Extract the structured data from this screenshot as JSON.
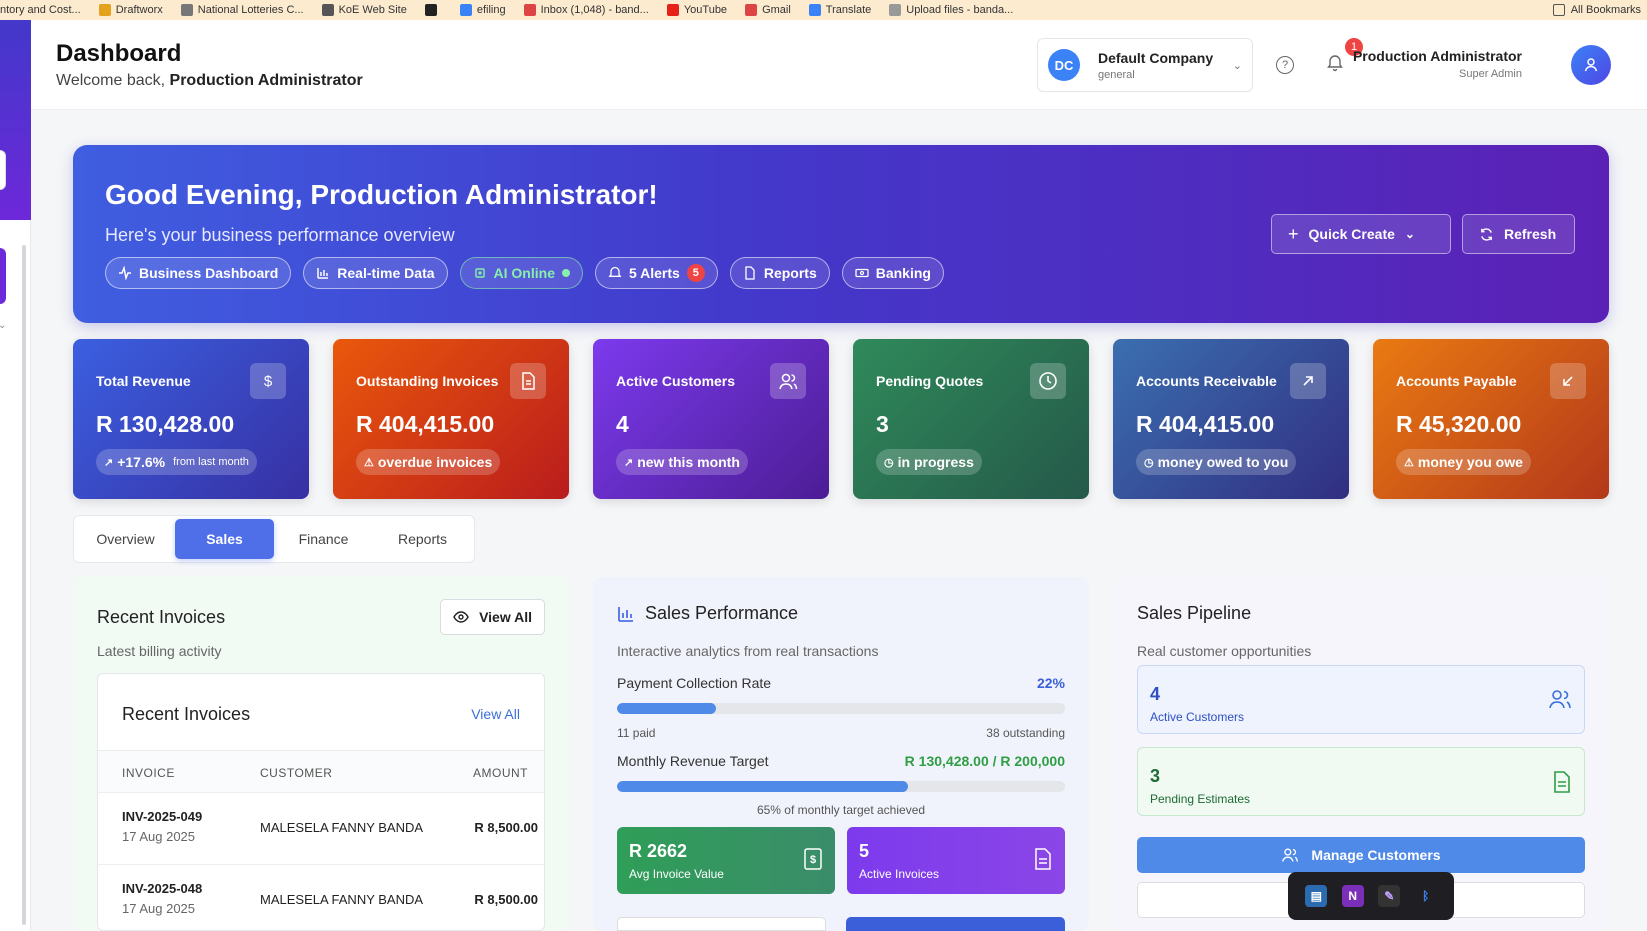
{
  "bookmarks": [
    {
      "label": "ntory and Cost...",
      "color": "#888"
    },
    {
      "label": "Draftworx",
      "color": "#e4a11b"
    },
    {
      "label": "National Lotteries C...",
      "color": "#777"
    },
    {
      "label": "KoE Web Site",
      "color": "#555"
    },
    {
      "label": "",
      "color": "#222"
    },
    {
      "label": "efiling",
      "color": "#3b82f6"
    },
    {
      "label": "Inbox (1,048) - band...",
      "color": "#d44"
    },
    {
      "label": "YouTube",
      "color": "#e62117"
    },
    {
      "label": "Gmail",
      "color": "#d44"
    },
    {
      "label": "Translate",
      "color": "#3b82f6"
    },
    {
      "label": "Upload files - banda...",
      "color": "#999"
    }
  ],
  "bookmarks_all": "All Bookmarks",
  "header": {
    "title": "Dashboard",
    "welcome_prefix": "Welcome back,",
    "welcome_name": "Production Administrator",
    "company_initials": "DC",
    "company_name": "Default Company",
    "company_sub": "general",
    "notifications": "1",
    "user_name": "Production Administrator",
    "user_role": "Super Admin"
  },
  "hero": {
    "greeting": "Good Evening, Production Administrator!",
    "subtitle": "Here's your business performance overview",
    "chips": {
      "business": "Business Dashboard",
      "realtime": "Real-time Data",
      "ai": "AI Online",
      "alerts": "5 Alerts",
      "alerts_count": "5",
      "reports": "Reports",
      "banking": "Banking"
    },
    "quick_create": "Quick Create",
    "refresh": "Refresh"
  },
  "kpis": [
    {
      "label": "Total Revenue",
      "value": "R 130,428.00",
      "pill": "+17.6%",
      "pill_note": "from last month",
      "icon": "dollar-icon",
      "gradient": [
        "#3b5fe0",
        "#3730a3"
      ]
    },
    {
      "label": "Outstanding Invoices",
      "value": "R 404,415.00",
      "pill": "overdue invoices",
      "icon": "document-icon",
      "gradient": [
        "#ea580c",
        "#b91c1c"
      ]
    },
    {
      "label": "Active Customers",
      "value": "4",
      "pill": "new this month",
      "icon": "users-icon",
      "gradient": [
        "#7c3aed",
        "#4c1d95"
      ]
    },
    {
      "label": "Pending Quotes",
      "value": "3",
      "pill": "in progress",
      "icon": "clock-icon",
      "gradient": [
        "#2f8a5a",
        "#25594a"
      ]
    },
    {
      "label": "Accounts Receivable",
      "value": "R 404,415.00",
      "pill": "money owed to you",
      "icon": "arrow-up-right-icon",
      "gradient": [
        "#3b6fb0",
        "#312e81"
      ]
    },
    {
      "label": "Accounts Payable",
      "value": "R 45,320.00",
      "pill": "money you owe",
      "icon": "arrow-down-left-icon",
      "gradient": [
        "#ea7a12",
        "#b3381a"
      ]
    }
  ],
  "tabs": [
    "Overview",
    "Sales",
    "Finance",
    "Reports"
  ],
  "active_tab": "Sales",
  "recent": {
    "title": "Recent Invoices",
    "subtitle": "Latest billing activity",
    "view_all_btn": "View All",
    "inner_title": "Recent Invoices",
    "inner_view_all": "View All",
    "columns": [
      "INVOICE",
      "CUSTOMER",
      "AMOUNT"
    ],
    "rows": [
      {
        "invoice": "INV-2025-049",
        "date": "17 Aug 2025",
        "customer": "MALESELA FANNY BANDA",
        "amount": "R 8,500.00"
      },
      {
        "invoice": "INV-2025-048",
        "date": "17 Aug 2025",
        "customer": "MALESELA FANNY BANDA",
        "amount": "R 8,500.00"
      }
    ]
  },
  "sales": {
    "title": "Sales Performance",
    "subtitle": "Interactive analytics from real transactions",
    "collection_label": "Payment Collection Rate",
    "collection_value": "22%",
    "collection_fraction": 0.22,
    "paid": "11 paid",
    "outstanding": "38 outstanding",
    "target_label": "Monthly Revenue Target",
    "target_value": "R 130,428.00 / R 200,000",
    "target_fraction": 0.65,
    "target_note": "65% of monthly target achieved",
    "avg_value": "R 2662",
    "avg_label": "Avg Invoice Value",
    "active_value": "5",
    "active_label": "Active Invoices"
  },
  "pipeline": {
    "title": "Sales Pipeline",
    "subtitle": "Real customer opportunities",
    "customers_value": "4",
    "customers_label": "Active Customers",
    "estimates_value": "3",
    "estimates_label": "Pending Estimates",
    "manage_btn": "Manage Customers"
  },
  "colors": {
    "accent": "#4f6fe8",
    "danger": "#ef4444",
    "success": "#2f9e44"
  }
}
